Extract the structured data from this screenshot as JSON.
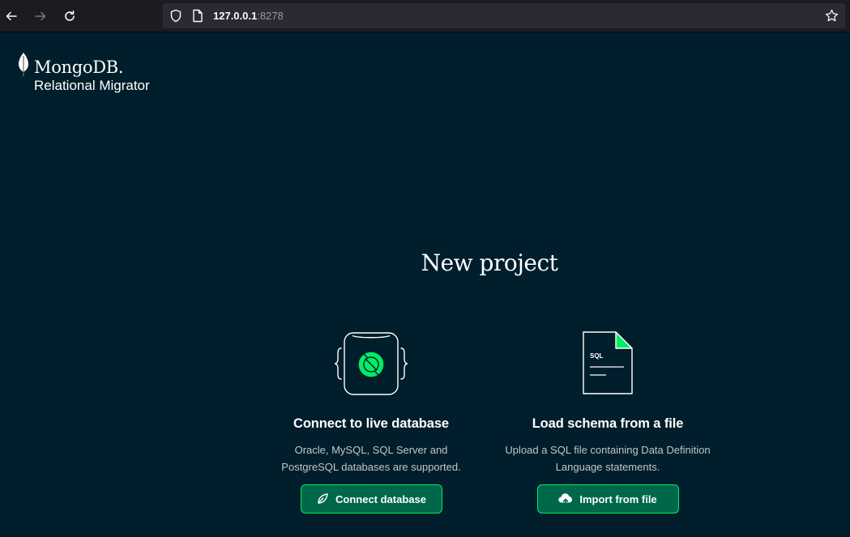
{
  "browser": {
    "url_host": "127.0.0.1",
    "url_port": ":8278"
  },
  "logo": {
    "name": "MongoDB.",
    "product": "Relational Migrator"
  },
  "main": {
    "title": "New project",
    "cards": [
      {
        "title": "Connect to live database",
        "description": "Oracle, MySQL, SQL Server and PostgreSQL databases are supported.",
        "button_label": "Connect database",
        "button_icon": "leaf-icon",
        "illustration": "database-connect-icon"
      },
      {
        "title": "Load schema from a file",
        "description": "Upload a SQL file containing Data Definition Language statements.",
        "button_label": "Import from file",
        "button_icon": "cloud-upload-icon",
        "illustration": "sql-file-icon",
        "illustration_text": "SQL"
      }
    ]
  },
  "colors": {
    "background": "#001e2b",
    "accent": "#00ed64",
    "button_bg": "#00684a"
  }
}
